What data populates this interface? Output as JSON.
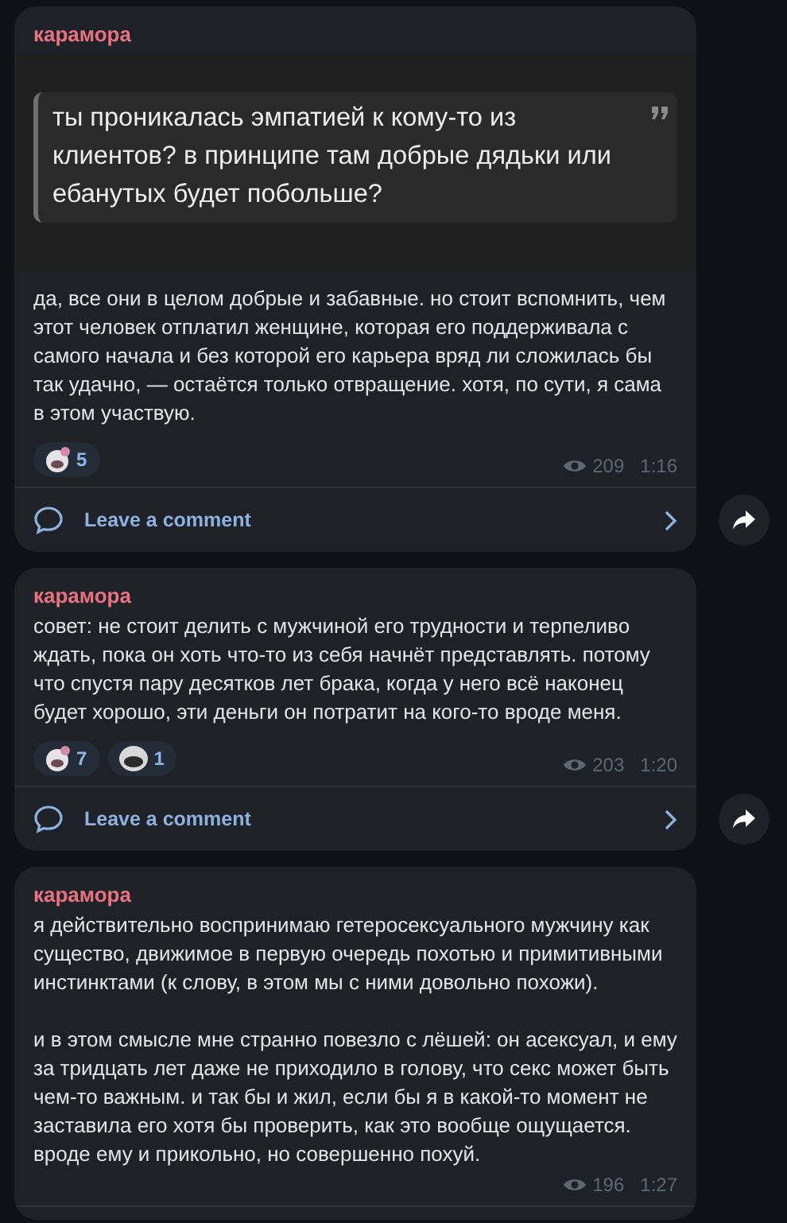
{
  "messages": [
    {
      "author": "карамора",
      "quote": "ты проникалась эмпатией к кому-то из клиентов? в принципе там добрые дядьки или ебанутых будет побольше?",
      "paragraphs": [
        "да, все они в целом добрые и забавные. но стоит вспомнить, чем этот человек отплатил женщине, которая его поддерживала с самого начала и без которой его карьера вряд ли сложилась бы так удачно, — остаётся только отвращение. хотя, по сути, я сама в этом участвую."
      ],
      "reactions": [
        {
          "kind": "bow",
          "count": "5"
        }
      ],
      "views": "209",
      "time": "1:16",
      "comment_label": "Leave a comment"
    },
    {
      "author": "карамора",
      "paragraphs": [
        "совет: не стоит делить с мужчиной его трудности и терпеливо ждать, пока он хоть что-то из себя начнёт представлять. потому что спустя пару десятков лет брака, когда у него всё наконец будет хорошо, эти деньги он потратит на кого-то вроде меня."
      ],
      "reactions": [
        {
          "kind": "bow",
          "count": "7"
        },
        {
          "kind": "grin",
          "count": "1"
        }
      ],
      "views": "203",
      "time": "1:20",
      "comment_label": "Leave a comment"
    },
    {
      "author": "карамора",
      "paragraphs": [
        "я действительно воспринимаю гетеросексуального мужчину как существо, движимое в первую очередь похотью и примитивными инстинктами (к слову, в этом мы с ними довольно похожи).",
        "и в этом смысле мне странно повезло с лёшей: он асексуал, и ему за тридцать лет даже не приходило в голову, что секс может быть чем-то важным. и так бы и жил, если бы я в какой-то момент не заставила его хотя бы проверить, как это вообще ощущается. вроде ему и прикольно, но совершенно похуй."
      ],
      "views": "196",
      "time": "1:27"
    }
  ]
}
